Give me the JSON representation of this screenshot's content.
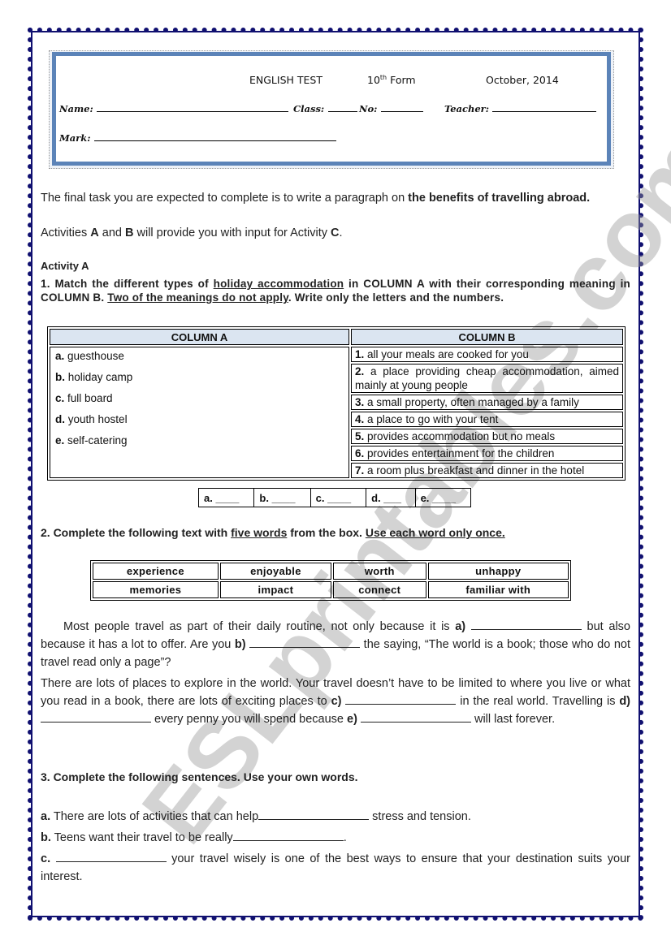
{
  "header": {
    "title": "ENGLISH TEST",
    "form_number": "10",
    "form_suffix": "th",
    "form_label": "Form",
    "date": "October, 2014",
    "name_label": "Name:",
    "class_label": "Class:",
    "no_label": "No:",
    "teacher_label": "Teacher:",
    "mark_label": "Mark:"
  },
  "intro": {
    "line1_plain": "The final task you are expected to complete is to write a paragraph on ",
    "line1_bold": "the benefits of travelling abroad.",
    "line2_part1": "Activities ",
    "line2_a": "A",
    "line2_part2": " and ",
    "line2_b": "B",
    "line2_part3": " will provide you with input for Activity ",
    "line2_c": "C",
    "line2_end": "."
  },
  "activity_a": {
    "title": "Activity A",
    "q1": {
      "p1": "1. Match the different types of ",
      "u1": "holiday accommodation",
      "p2": " in COLUMN A with their corresponding meaning in COLUMN B. ",
      "u2": "Two of the meanings do not apply",
      "p3": ". Write only the letters and the numbers."
    },
    "column_a_header": "COLUMN A",
    "column_b_header": "COLUMN B",
    "column_a": [
      {
        "letter": "a.",
        "text": "guesthouse"
      },
      {
        "letter": "b.",
        "text": "holiday camp"
      },
      {
        "letter": "c.",
        "text": "full board"
      },
      {
        "letter": "d.",
        "text": "youth hostel"
      },
      {
        "letter": "e.",
        "text": "self-catering"
      }
    ],
    "column_b": [
      {
        "num": "1.",
        "text": "all your meals are cooked for you"
      },
      {
        "num": "2.",
        "text": "a place providing cheap accommodation, aimed mainly at young people"
      },
      {
        "num": "3.",
        "text": "a small property, often managed by a family"
      },
      {
        "num": "4.",
        "text": "a place to go with your tent"
      },
      {
        "num": "5.",
        "text": "provides accommodation but no meals"
      },
      {
        "num": "6.",
        "text": "provides entertainment for the children"
      },
      {
        "num": "7.",
        "text": "a room plus breakfast and dinner in the hotel"
      }
    ],
    "answer_cells": [
      "a. ____",
      "b. ____",
      "c. ____",
      "d. ___",
      "e. ____"
    ]
  },
  "q2": {
    "p1": "2. Complete the following text with ",
    "u1": "five words",
    "p2": " from the box. ",
    "u2": "Use each word only once.",
    "words": [
      [
        "experience",
        "enjoyable",
        "worth",
        "unhappy"
      ],
      [
        "memories",
        "impact",
        "connect",
        "familiar with"
      ]
    ],
    "para1": {
      "s1": "Most people travel as part of their daily routine, not only because it is ",
      "a": "a)",
      "s2": " but also because it has a lot to offer. Are you ",
      "b": "b)",
      "s3": " the saying, “The world is a book; those who do not travel read only a page”?"
    },
    "para2": {
      "s1": "There are lots of places to explore in the world. Your travel doesn’t have to be limited to where you live or what you read in a book, there are lots of exciting places to ",
      "c": "c)",
      "s2": " in the real world. Travelling is ",
      "d": "d)",
      "s3": " every penny you will spend because ",
      "e": "e)",
      "s4": " will last forever."
    }
  },
  "q3": {
    "title": "3. Complete the following sentences.  Use your own words.",
    "a_label": "a.",
    "a_p1": " There are lots of activities that can help",
    "a_p2": " stress and tension.",
    "b_label": "b.",
    "b_p1": " Teens want their travel to be really",
    "b_p2": ".",
    "c_label": "c.",
    "c_p2": " your travel wisely is one of the best ways to ensure that your destination suits your interest."
  },
  "watermark": "ESLprintables.com"
}
